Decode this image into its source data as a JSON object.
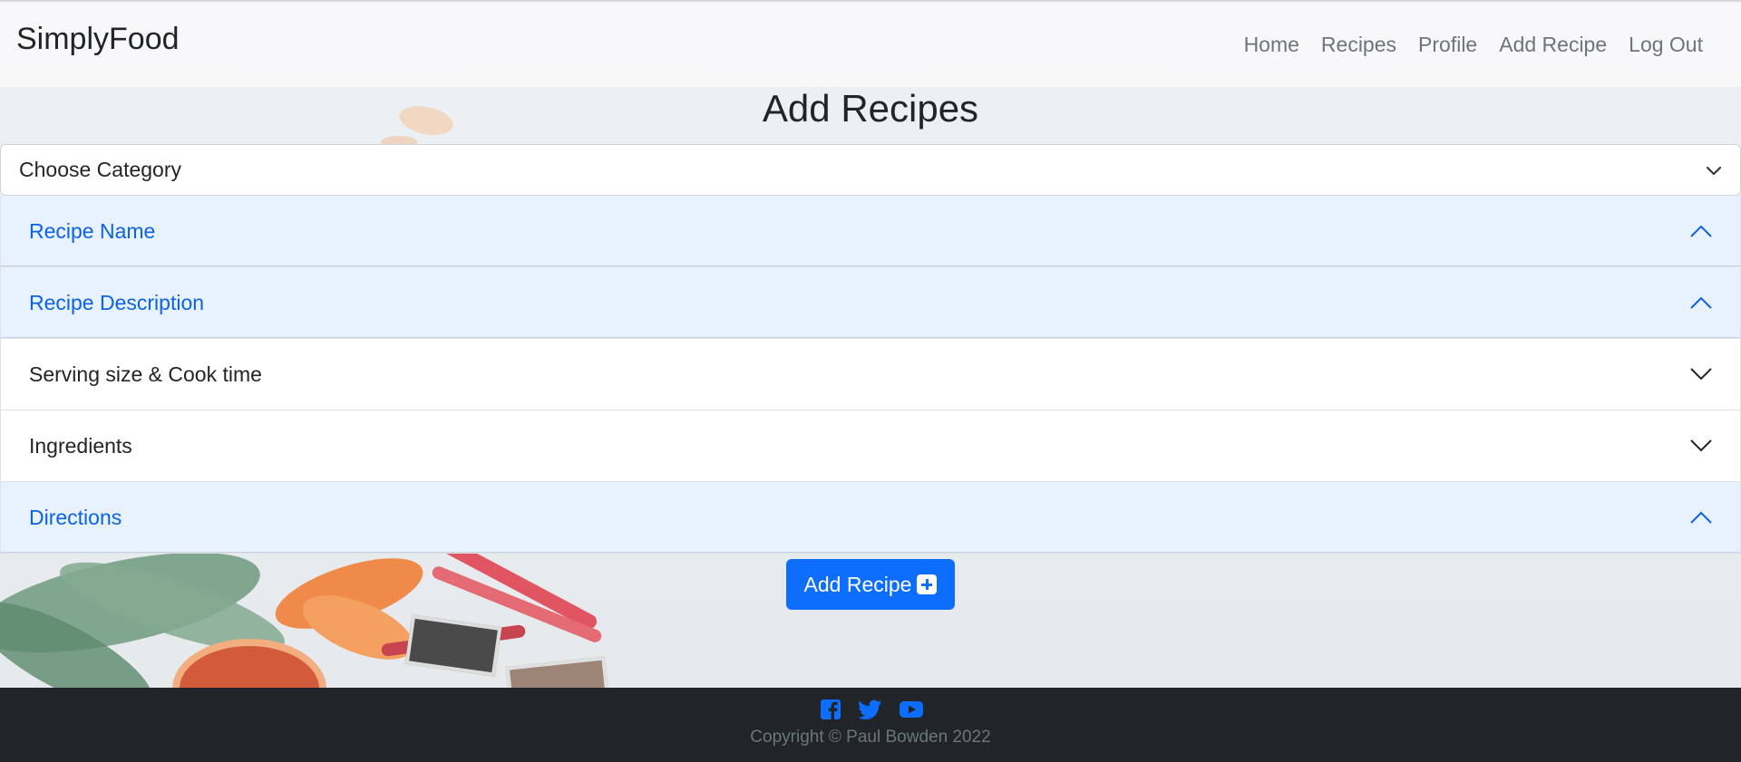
{
  "navbar": {
    "brand": "SimplyFood",
    "links": [
      "Home",
      "Recipes",
      "Profile",
      "Add Recipe",
      "Log Out"
    ]
  },
  "page": {
    "title": "Add Recipes"
  },
  "form": {
    "category_select": {
      "selected": "Choose Category"
    },
    "accordion": [
      {
        "label": "Recipe Name",
        "state": "expanded"
      },
      {
        "label": "Recipe Description",
        "state": "expanded"
      },
      {
        "label": "Serving size & Cook time",
        "state": "collapsed"
      },
      {
        "label": "Ingredients",
        "state": "collapsed"
      },
      {
        "label": "Directions",
        "state": "expanded"
      }
    ],
    "submit_label": "Add Recipe"
  },
  "footer": {
    "social_icons": [
      "facebook-icon",
      "twitter-icon",
      "youtube-icon"
    ],
    "copyright": "Copyright © Paul Bowden 2022"
  },
  "colors": {
    "accent": "#0d6efd",
    "accordion_open_bg": "#e7f1ff",
    "accordion_open_text": "#0c63e4",
    "footer_bg": "#212529"
  }
}
